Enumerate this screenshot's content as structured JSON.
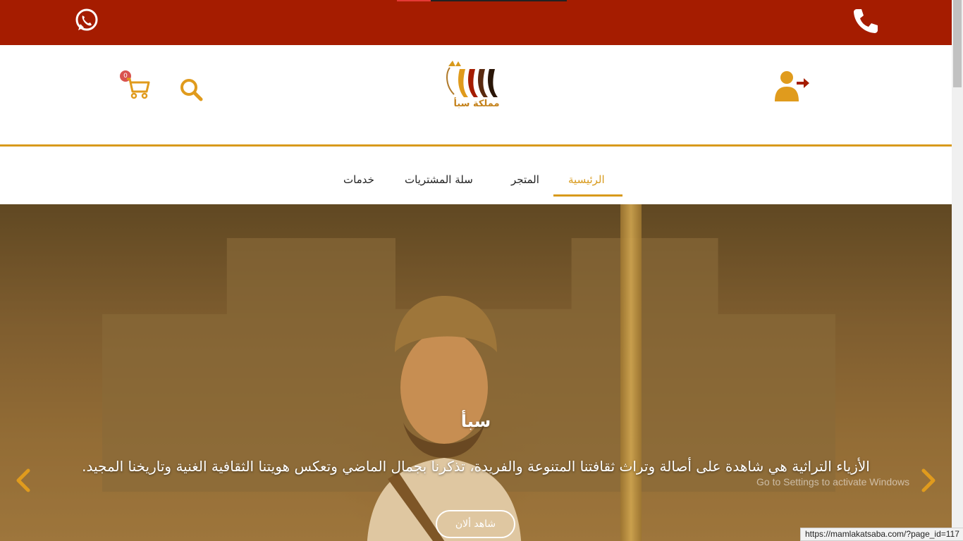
{
  "topbar": {
    "whatsapp_icon": "whatsapp-icon",
    "phone_icon": "phone-icon"
  },
  "header": {
    "cart_count": "0",
    "cart_icon": "cart-icon",
    "search_icon": "search-icon",
    "login_icon": "user-login-icon",
    "logo_text": "مملكة سبأ"
  },
  "nav": {
    "items": [
      {
        "label": "الرئيسية",
        "active": true
      },
      {
        "label": "المتجر",
        "active": false
      },
      {
        "label": "سلة المشتريات",
        "active": false
      },
      {
        "label": "خدمات",
        "active": false
      }
    ]
  },
  "hero": {
    "title": "سبأ",
    "text": "الأزياء التراثية هي شاهدة على أصالة وتراث ثقافتنا المتنوعة والفريدة، تذكرنا بجمال الماضي وتعكس هويتنا الثقافية الغنية وتاريخنا المجيد.",
    "cta_label": "شاهد ألان",
    "watermark": "Go to Settings to activate Windows"
  },
  "status_url": "https://mamlakatsaba.com/?page_id=117",
  "colors": {
    "topbar": "#a51c00",
    "accent": "#d89a1c",
    "cart_badge": "#d9534f"
  }
}
